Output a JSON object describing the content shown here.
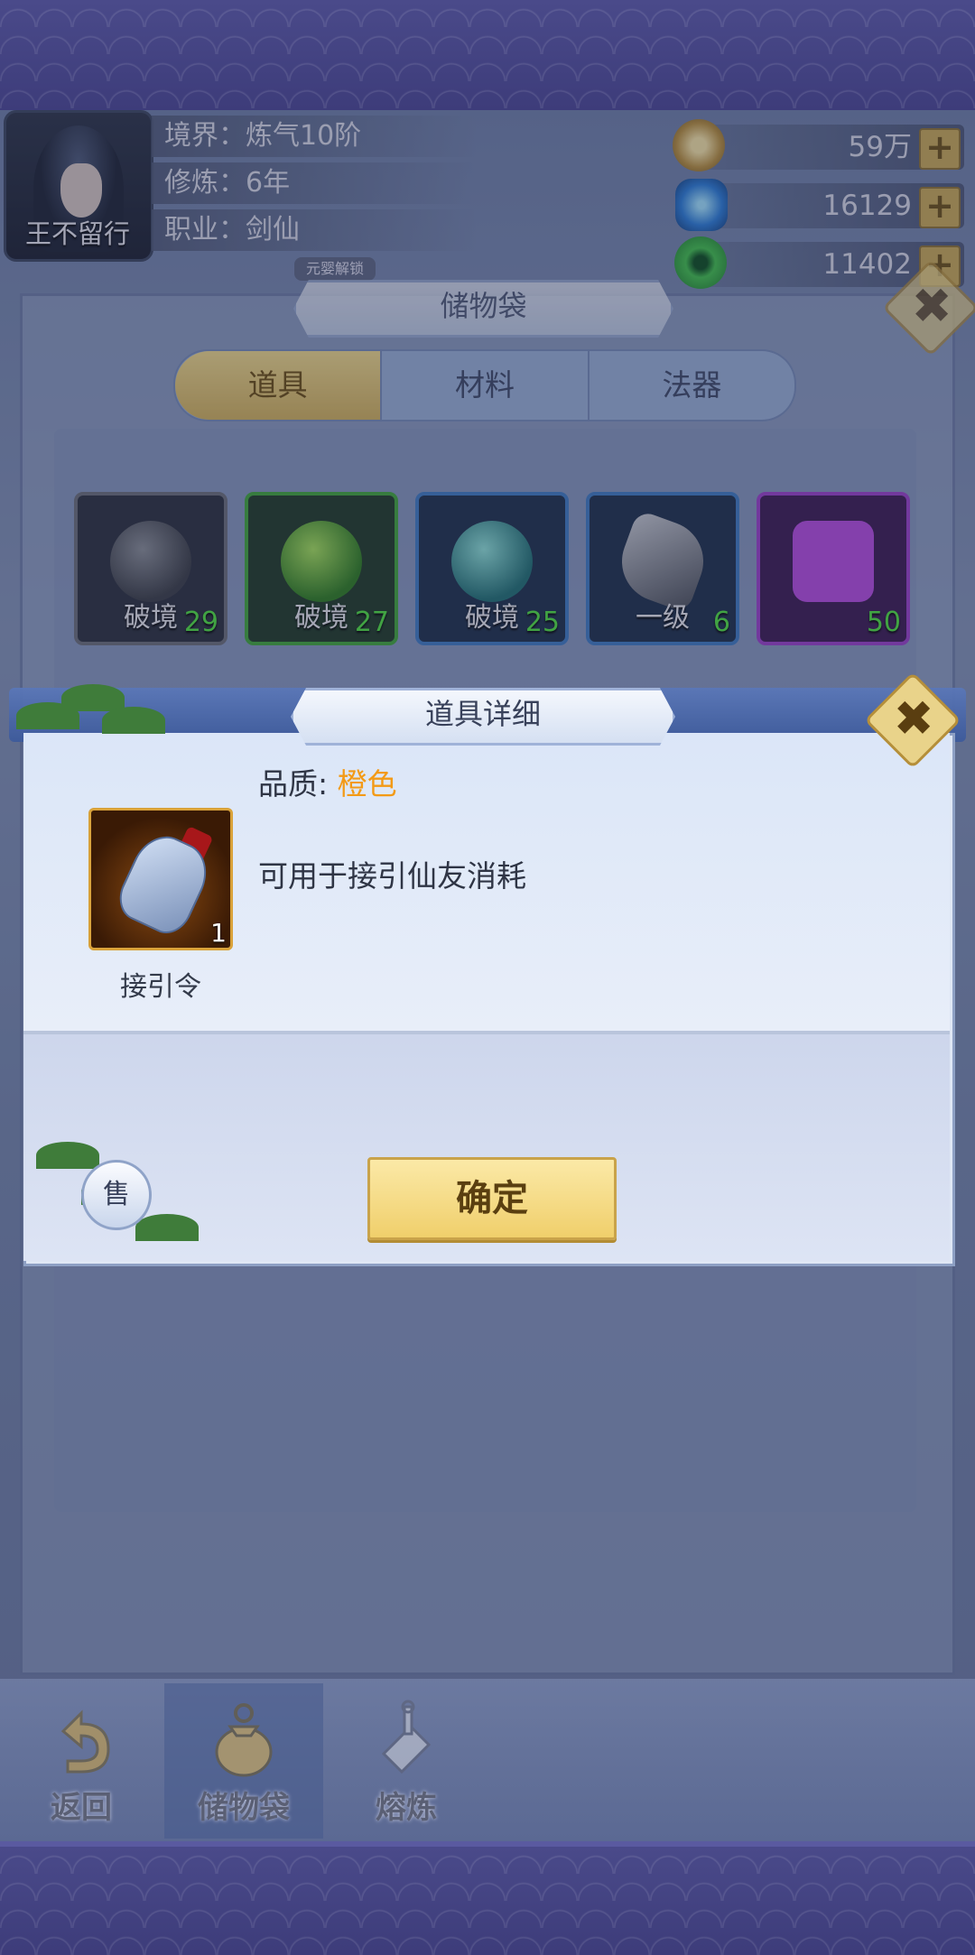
{
  "player": {
    "name": "王不留行",
    "realm": "境界：炼气10阶",
    "cultivation": "修炼：6年",
    "profession": "职业：剑仙"
  },
  "resources": [
    {
      "icon": "coin-icon",
      "value": "59万"
    },
    {
      "icon": "blue-crystal-icon",
      "value": "16129"
    },
    {
      "icon": "green-jade-icon",
      "value": "11402"
    }
  ],
  "resource_plus": "+",
  "bag": {
    "title": "储物袋",
    "unlock_badge": "元婴解锁",
    "tabs": [
      "道具",
      "材料",
      "法器"
    ],
    "items": [
      {
        "label": "破境",
        "count": "29",
        "color": "gray"
      },
      {
        "label": "破境",
        "count": "27",
        "color": "green"
      },
      {
        "label": "破境",
        "count": "25",
        "color": "teal"
      },
      {
        "label": "一级",
        "count": "6",
        "color": "blue"
      },
      {
        "label": "",
        "count": "50",
        "color": "purple"
      }
    ]
  },
  "detail": {
    "title": "道具详细",
    "quality_label": "品质: ",
    "quality_value": "橙色",
    "description": "可用于接引仙友消耗",
    "item_name": "接引令",
    "item_count": "1",
    "sell": "售",
    "confirm": "确定",
    "close": "✖"
  },
  "nav": [
    {
      "label": "返回",
      "icon": "return-arrow-icon"
    },
    {
      "label": "储物袋",
      "icon": "storage-bag-icon"
    },
    {
      "label": "熔炼",
      "icon": "smelt-icon"
    }
  ],
  "colors": {
    "quality_orange": "#f39a16",
    "count_green": "#4fe23f",
    "confirm_gold": "#f0cf6b"
  }
}
